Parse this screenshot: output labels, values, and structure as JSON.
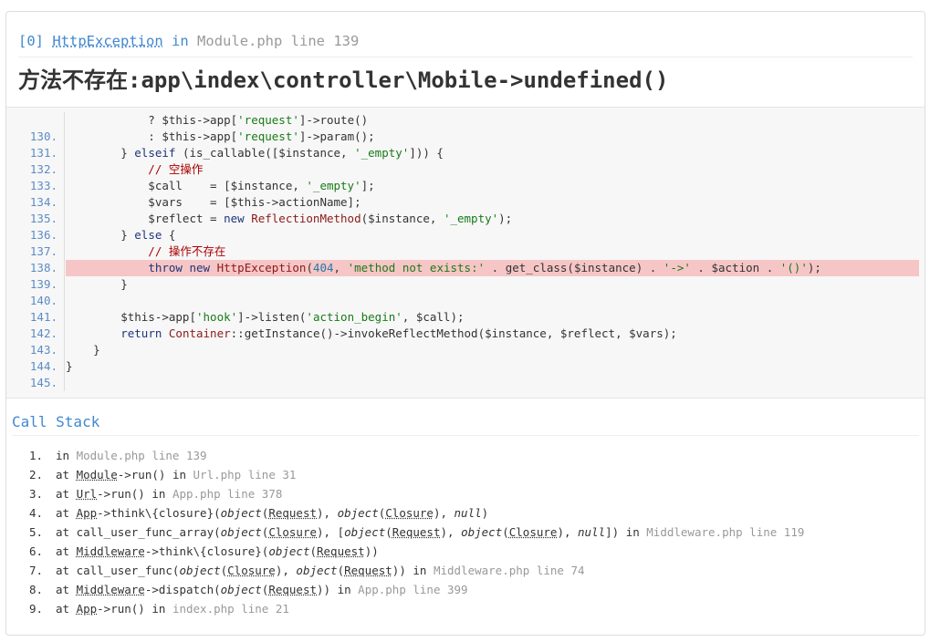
{
  "exception": {
    "index": "[0]",
    "class": "HttpException",
    "in_word": "in",
    "file_line": "Module.php line 139",
    "message": "方法不存在:app\\index\\controller\\Mobile->undefined()"
  },
  "source": {
    "highlight_line": "138.",
    "lines": [
      {
        "n": "",
        "t": "            ? $this->app['request']->route()"
      },
      {
        "n": "130.",
        "t": "            : $this->app['request']->param();"
      },
      {
        "n": "131.",
        "t": "        } elseif (is_callable([$instance, '_empty'])) {"
      },
      {
        "n": "132.",
        "t": "            // 空操作"
      },
      {
        "n": "133.",
        "t": "            $call    = [$instance, '_empty'];"
      },
      {
        "n": "134.",
        "t": "            $vars    = [$this->actionName];"
      },
      {
        "n": "135.",
        "t": "            $reflect = new ReflectionMethod($instance, '_empty');"
      },
      {
        "n": "136.",
        "t": "        } else {"
      },
      {
        "n": "137.",
        "t": "            // 操作不存在"
      },
      {
        "n": "138.",
        "t": "            throw new HttpException(404, 'method not exists:' . get_class($instance) . '->' . $action . '()');"
      },
      {
        "n": "139.",
        "t": "        }"
      },
      {
        "n": "140.",
        "t": ""
      },
      {
        "n": "141.",
        "t": "        $this->app['hook']->listen('action_begin', $call);"
      },
      {
        "n": "142.",
        "t": "        return Container::getInstance()->invokeReflectMethod($instance, $reflect, $vars);"
      },
      {
        "n": "143.",
        "t": "    }"
      },
      {
        "n": "144.",
        "t": "}"
      },
      {
        "n": "145.",
        "t": ""
      }
    ]
  },
  "call_stack": {
    "title": "Call Stack",
    "items": [
      {
        "n": "1.",
        "parts": [
          [
            "in ",
            ""
          ],
          [
            "Module.php line 139",
            "f"
          ]
        ]
      },
      {
        "n": "2.",
        "parts": [
          [
            "at ",
            ""
          ],
          [
            "Module",
            "u"
          ],
          [
            "->run() in ",
            ""
          ],
          [
            "Url.php line 31",
            "f"
          ]
        ]
      },
      {
        "n": "3.",
        "parts": [
          [
            "at ",
            ""
          ],
          [
            "Url",
            "u"
          ],
          [
            "->run() in ",
            ""
          ],
          [
            "App.php line 378",
            "f"
          ]
        ]
      },
      {
        "n": "4.",
        "parts": [
          [
            "at ",
            ""
          ],
          [
            "App",
            "u"
          ],
          [
            "->think\\{closure}(",
            ""
          ],
          [
            "object",
            "i"
          ],
          [
            "(",
            ""
          ],
          [
            "Request",
            "u"
          ],
          [
            "), ",
            ""
          ],
          [
            "object",
            "i"
          ],
          [
            "(",
            ""
          ],
          [
            "Closure",
            "u"
          ],
          [
            "), ",
            ""
          ],
          [
            "null",
            "i"
          ],
          [
            ")",
            ""
          ]
        ]
      },
      {
        "n": "5.",
        "parts": [
          [
            "at call_user_func_array(",
            ""
          ],
          [
            "object",
            "i"
          ],
          [
            "(",
            ""
          ],
          [
            "Closure",
            "u"
          ],
          [
            "), [",
            ""
          ],
          [
            "object",
            "i"
          ],
          [
            "(",
            ""
          ],
          [
            "Request",
            "u"
          ],
          [
            "), ",
            ""
          ],
          [
            "object",
            "i"
          ],
          [
            "(",
            ""
          ],
          [
            "Closure",
            "u"
          ],
          [
            "), ",
            ""
          ],
          [
            "null",
            "i"
          ],
          [
            "]) in ",
            ""
          ],
          [
            "Middleware.php line 119",
            "f"
          ]
        ]
      },
      {
        "n": "6.",
        "parts": [
          [
            "at ",
            ""
          ],
          [
            "Middleware",
            "u"
          ],
          [
            "->think\\{closure}(",
            ""
          ],
          [
            "object",
            "i"
          ],
          [
            "(",
            ""
          ],
          [
            "Request",
            "u"
          ],
          [
            "))",
            ""
          ]
        ]
      },
      {
        "n": "7.",
        "parts": [
          [
            "at call_user_func(",
            ""
          ],
          [
            "object",
            "i"
          ],
          [
            "(",
            ""
          ],
          [
            "Closure",
            "u"
          ],
          [
            "), ",
            ""
          ],
          [
            "object",
            "i"
          ],
          [
            "(",
            ""
          ],
          [
            "Request",
            "u"
          ],
          [
            ")) in ",
            ""
          ],
          [
            "Middleware.php line 74",
            "f"
          ]
        ]
      },
      {
        "n": "8.",
        "parts": [
          [
            "at ",
            ""
          ],
          [
            "Middleware",
            "u"
          ],
          [
            "->dispatch(",
            ""
          ],
          [
            "object",
            "i"
          ],
          [
            "(",
            ""
          ],
          [
            "Request",
            "u"
          ],
          [
            ")) in ",
            ""
          ],
          [
            "App.php line 399",
            "f"
          ]
        ]
      },
      {
        "n": "9.",
        "parts": [
          [
            "at ",
            ""
          ],
          [
            "App",
            "u"
          ],
          [
            "->run() in ",
            ""
          ],
          [
            "index.php line 21",
            "f"
          ]
        ]
      }
    ]
  },
  "colors": {
    "accent": "#4288ce",
    "muted": "#999999",
    "highlight": "#f6c6c6",
    "code_bg": "#f7f7f7"
  }
}
